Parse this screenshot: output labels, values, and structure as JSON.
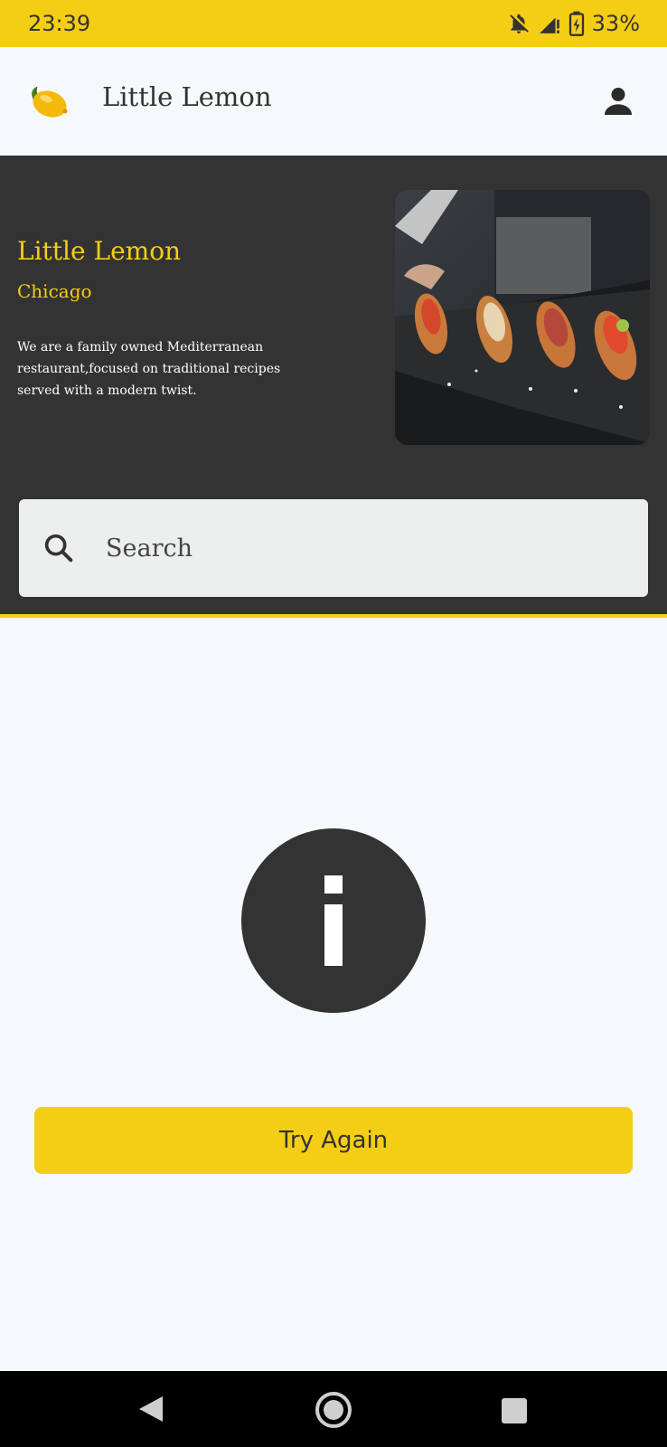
{
  "status_bar": {
    "time": "23:39",
    "battery": "33%"
  },
  "app_bar": {
    "title": "Little Lemon",
    "logo_icon": "lemon-logo",
    "profile_icon": "person-icon"
  },
  "hero": {
    "title": "Little Lemon",
    "subtitle": "Chicago",
    "description": "We are a family owned Mediterranean restaurant,focused on traditional recipes served with a modern twist.",
    "image_icon": "hero-food-image"
  },
  "search": {
    "placeholder": "Search",
    "value": ""
  },
  "error_state": {
    "icon": "info-icon"
  },
  "actions": {
    "try_again_label": "Try Again"
  },
  "colors": {
    "primary": "#f4ce14",
    "dark": "#333333",
    "background": "#f6f9fc",
    "search_bg": "#edefee"
  }
}
